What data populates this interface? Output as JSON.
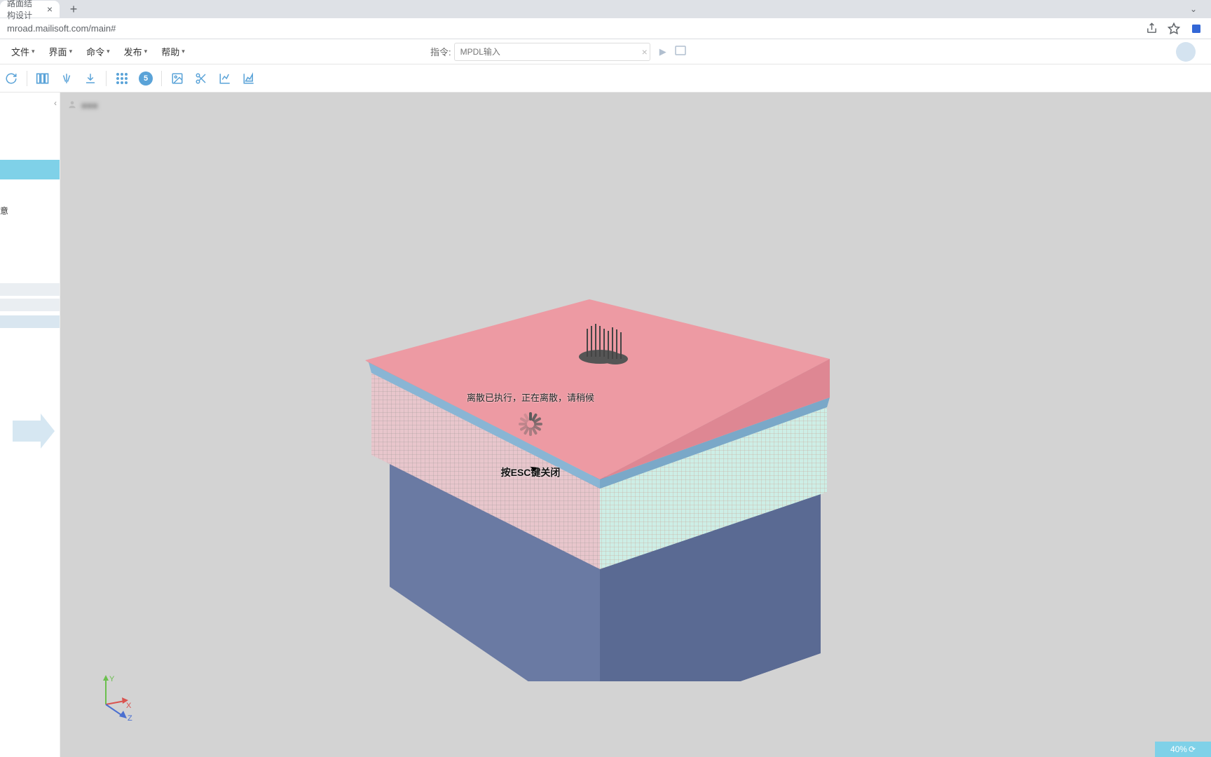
{
  "browser": {
    "tab_title": "路面结构设计",
    "url": "mroad.mailisoft.com/main#"
  },
  "menu": {
    "items": [
      "文件",
      "界面",
      "命令",
      "发布",
      "帮助"
    ]
  },
  "command": {
    "label": "指令:",
    "placeholder": "MPDL输入"
  },
  "toolbar": {
    "badge_value": "5"
  },
  "breadcrumb": {
    "item": ""
  },
  "loading": {
    "status": "离散已执行，正在离散，请稍候",
    "esc_hint": "按ESC键关闭"
  },
  "axis": {
    "x": "X",
    "y": "Y",
    "z": "Z"
  },
  "progress": {
    "value": "40%",
    "icon": "⟳"
  }
}
